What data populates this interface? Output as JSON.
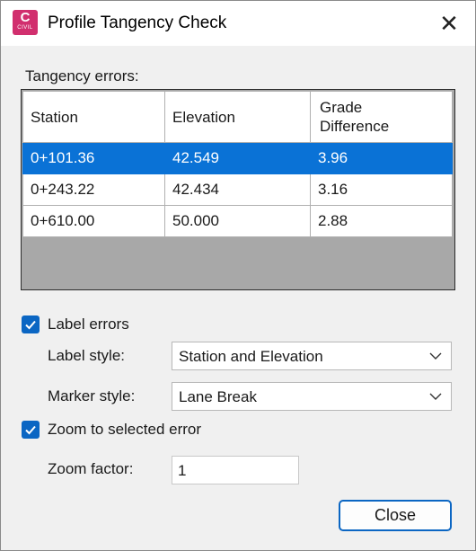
{
  "window": {
    "title": "Profile Tangency Check",
    "app_icon_letter": "C",
    "app_icon_sub": "CIVIL",
    "close_glyph": "✕"
  },
  "errors_section": {
    "label": "Tangency errors:",
    "columns": [
      "Station",
      "Elevation",
      "Grade Difference"
    ],
    "rows": [
      {
        "station": "0+101.36",
        "elevation": "42.549",
        "grade_difference": "3.96",
        "selected": true
      },
      {
        "station": "0+243.22",
        "elevation": "42.434",
        "grade_difference": "3.16",
        "selected": false
      },
      {
        "station": "0+610.00",
        "elevation": "50.000",
        "grade_difference": "2.88",
        "selected": false
      }
    ]
  },
  "label_errors": {
    "checked": true,
    "label": "Label errors",
    "label_style": {
      "label": "Label style:",
      "value": "Station and Elevation"
    },
    "marker_style": {
      "label": "Marker style:",
      "value": "Lane Break"
    }
  },
  "zoom": {
    "checked": true,
    "label": "Zoom to selected error",
    "factor_label": "Zoom factor:",
    "factor_value": "1"
  },
  "buttons": {
    "close": "Close"
  },
  "colors": {
    "accent": "#0b66c3",
    "selection": "#0a72d6",
    "app_icon": "#d12f6e"
  }
}
